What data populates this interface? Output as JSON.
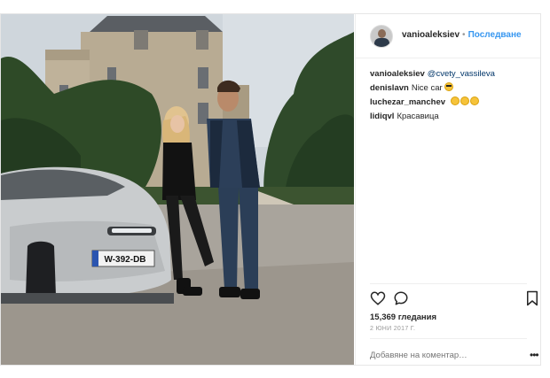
{
  "post": {
    "author": {
      "username": "vanioaleksiev",
      "follow_label": "Последване",
      "separator": "•"
    },
    "caption": {
      "username": "vanioaleksiev",
      "mention": "@cvety_vassileva"
    },
    "comments": [
      {
        "username": "denislavn",
        "text": "Nice car"
      },
      {
        "username": "luchezar_manchev",
        "text": ""
      },
      {
        "username": "lidiqvl",
        "text": "Красавица"
      }
    ],
    "photo": {
      "license_plate": "W-392-DB"
    },
    "views": "15,369 гледания",
    "date": "2 ЮНИ 2017 Г.",
    "add_comment_placeholder": "Добавяне на коментар…",
    "more": "•••"
  },
  "icons": {
    "like": "heart-icon",
    "comment": "speech-bubble-icon",
    "bookmark": "bookmark-icon",
    "more": "more-options-icon"
  },
  "colors": {
    "follow": "#3897f0",
    "text": "#262626",
    "muted": "#999999",
    "border": "#efefef"
  }
}
